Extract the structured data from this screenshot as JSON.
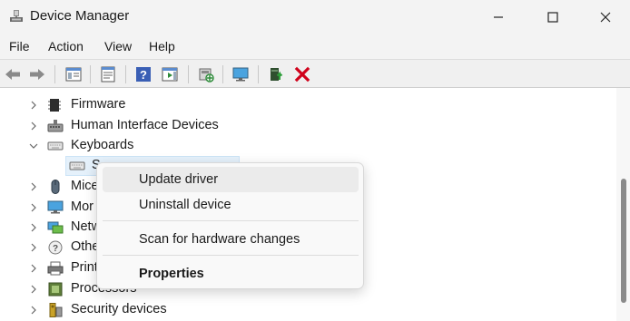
{
  "window": {
    "title": "Device Manager",
    "icon": "device-manager-icon"
  },
  "menu": [
    "File",
    "Action",
    "View",
    "Help"
  ],
  "toolbar": {
    "buttons": [
      "back-icon",
      "forward-icon",
      "show-hide-console-tree-icon",
      "properties-icon",
      "help-icon",
      "action-pane-icon",
      "scan-hardware-icon",
      "monitor-icon",
      "update-driver-icon",
      "uninstall-icon"
    ]
  },
  "tree": {
    "items": [
      {
        "label": "Firmware",
        "icon": "firmware-icon"
      },
      {
        "label": "Human Interface Devices",
        "icon": "hid-icon"
      },
      {
        "label": "Keyboards",
        "icon": "keyboard-icon"
      },
      {
        "label": "Mice",
        "icon": "mouse-icon"
      },
      {
        "label": "Mor",
        "icon": "monitor-icon"
      },
      {
        "label": "Netw",
        "icon": "network-icon"
      },
      {
        "label": "Othe",
        "icon": "other-devices-icon"
      },
      {
        "label": "Print",
        "icon": "print-queue-icon"
      },
      {
        "label": "Processors",
        "icon": "processor-icon"
      },
      {
        "label": "Security devices",
        "icon": "security-icon"
      }
    ],
    "selected_child": {
      "label": "S",
      "icon": "keyboard-device-icon"
    }
  },
  "context_menu": {
    "items": [
      "Update driver",
      "Uninstall device",
      "Scan for hardware changes",
      "Properties"
    ]
  },
  "colors": {
    "titlebar": "#f3f3f3",
    "selection": "#e5f1fb",
    "menu_hover": "#ebebeb",
    "close_red": "#d0021b"
  }
}
